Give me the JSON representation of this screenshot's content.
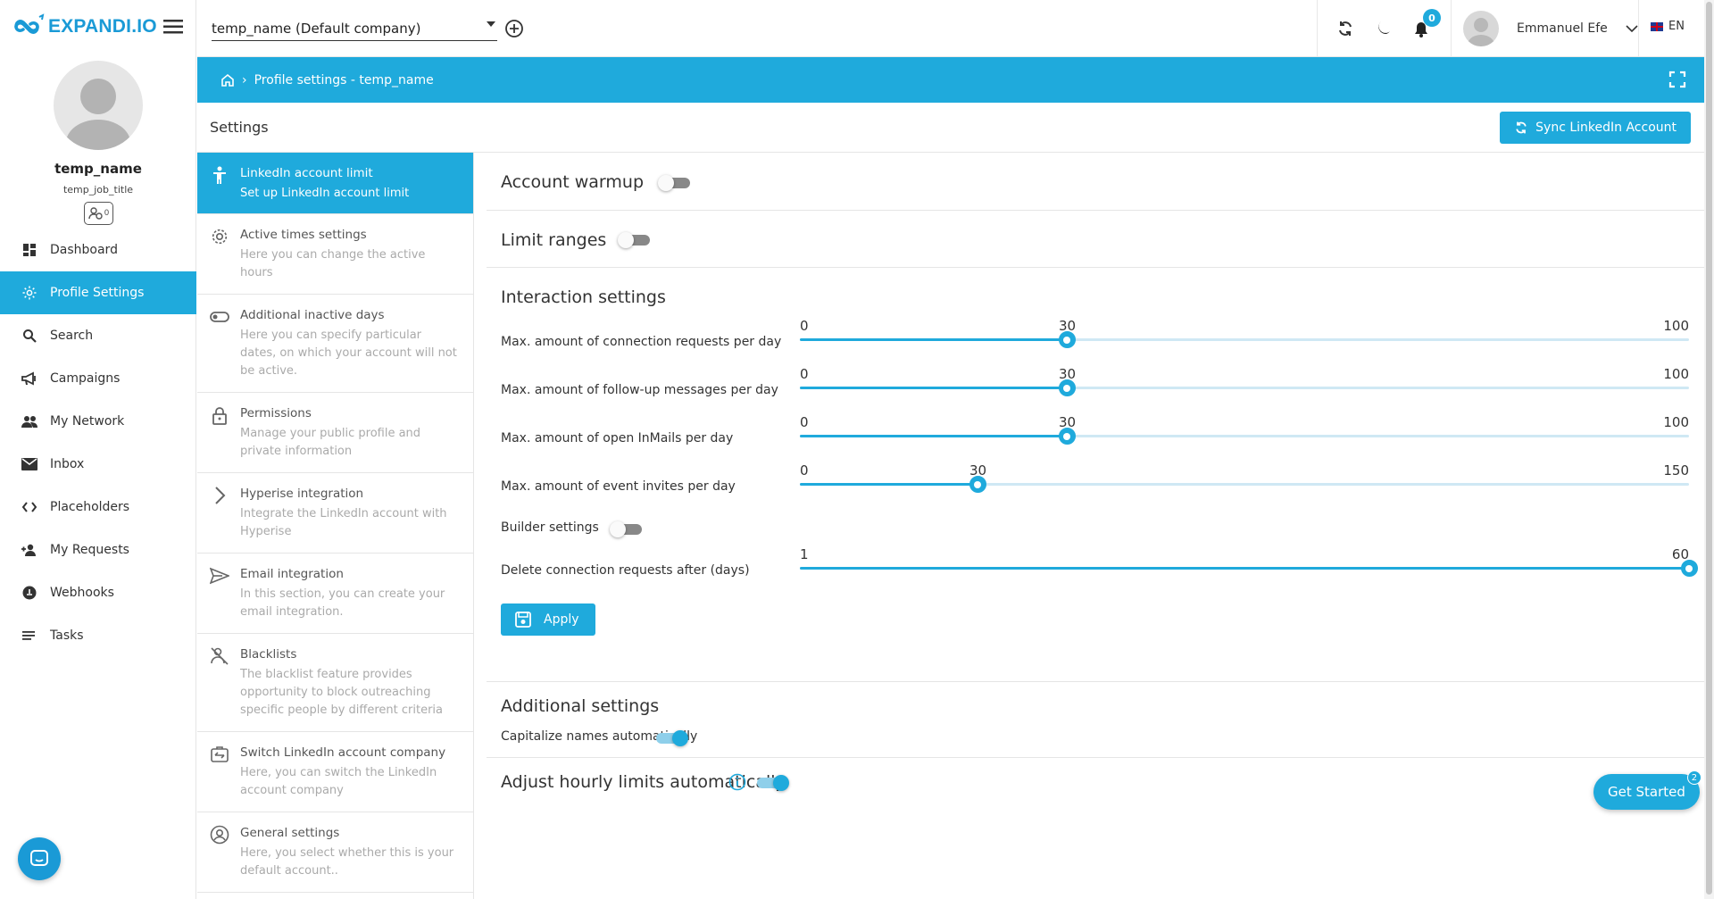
{
  "app": {
    "logo_text": "EXPANDI.IO"
  },
  "profile": {
    "name": "temp_name",
    "job_title": "temp_job_title",
    "badge_count": "0"
  },
  "nav": [
    {
      "label": "Dashboard",
      "icon": "dashboard-icon",
      "active": false
    },
    {
      "label": "Profile Settings",
      "icon": "gear-icon",
      "active": true
    },
    {
      "label": "Search",
      "icon": "search-icon",
      "active": false
    },
    {
      "label": "Campaigns",
      "icon": "megaphone-icon",
      "active": false
    },
    {
      "label": "My Network",
      "icon": "people-icon",
      "active": false
    },
    {
      "label": "Inbox",
      "icon": "envelope-icon",
      "active": false
    },
    {
      "label": "Placeholders",
      "icon": "code-icon",
      "active": false
    },
    {
      "label": "My Requests",
      "icon": "add-user-icon",
      "active": false
    },
    {
      "label": "Webhooks",
      "icon": "webhook-icon",
      "active": false
    },
    {
      "label": "Tasks",
      "icon": "list-icon",
      "active": false
    }
  ],
  "topbar": {
    "company_select_value": "temp_name (Default company)",
    "notification_count": "0",
    "user_name": "Emmanuel Efe",
    "language": "EN"
  },
  "breadcrumb": {
    "label": "Profile settings - temp_name"
  },
  "settings": {
    "title": "Settings",
    "sync_button": "Sync LinkedIn Account"
  },
  "settings_menu": [
    {
      "title": "LinkedIn account limit",
      "description": "Set up LinkedIn account limit",
      "icon": "person-icon",
      "active": true
    },
    {
      "title": "Active times settings",
      "description": "Here you can change the active hours",
      "icon": "gear-icon",
      "active": false
    },
    {
      "title": "Additional inactive days",
      "description": "Here you can specify particular dates, on which your account will not be active.",
      "icon": "toggle-icon",
      "active": false
    },
    {
      "title": "Permissions",
      "description": "Manage your public profile and private information",
      "icon": "lock-icon",
      "active": false
    },
    {
      "title": "Hyperise integration",
      "description": "Integrate the LinkedIn account with Hyperise",
      "icon": "chevron-right-icon",
      "active": false
    },
    {
      "title": "Email integration",
      "description": "In this section, you can create your email integration.",
      "icon": "send-icon",
      "active": false
    },
    {
      "title": "Blacklists",
      "description": "The blacklist feature provides opportunity to block outreaching specific people by different criteria",
      "icon": "block-user-icon",
      "active": false
    },
    {
      "title": "Switch LinkedIn account company",
      "description": "Here, you can switch the LinkedIn account company",
      "icon": "switch-icon",
      "active": false
    },
    {
      "title": "General settings",
      "description": "Here, you select whether this is your default account..",
      "icon": "user-circle-icon",
      "active": false
    }
  ],
  "main": {
    "account_warmup": {
      "label": "Account warmup",
      "enabled": false
    },
    "limit_ranges": {
      "label": "Limit ranges",
      "enabled": false
    },
    "interaction_title": "Interaction settings",
    "sliders": [
      {
        "label": "Max. amount of connection requests per day",
        "min": 0,
        "max": 100,
        "value": 30
      },
      {
        "label": "Max. amount of follow-up messages per day",
        "min": 0,
        "max": 100,
        "value": 30
      },
      {
        "label": "Max. amount of open InMails per day",
        "min": 0,
        "max": 100,
        "value": 30
      },
      {
        "label": "Max. amount of event invites per day",
        "min": 0,
        "max": 150,
        "value": 30
      }
    ],
    "builder_settings": {
      "label": "Builder settings",
      "enabled": false
    },
    "delete_requests": {
      "label": "Delete connection requests after (days)",
      "min": 1,
      "max": 60,
      "value": 60
    },
    "apply_label": "Apply",
    "additional_title": "Additional settings",
    "capitalize": {
      "label": "Capitalize names automatically",
      "enabled": true
    },
    "adjust_hourly": {
      "label": "Adjust hourly limits automatically",
      "enabled": true
    }
  },
  "widgets": {
    "get_started": "Get Started",
    "get_started_badge": "2"
  },
  "colors": {
    "accent": "#1faadc",
    "logo": "#1a9ad6"
  }
}
